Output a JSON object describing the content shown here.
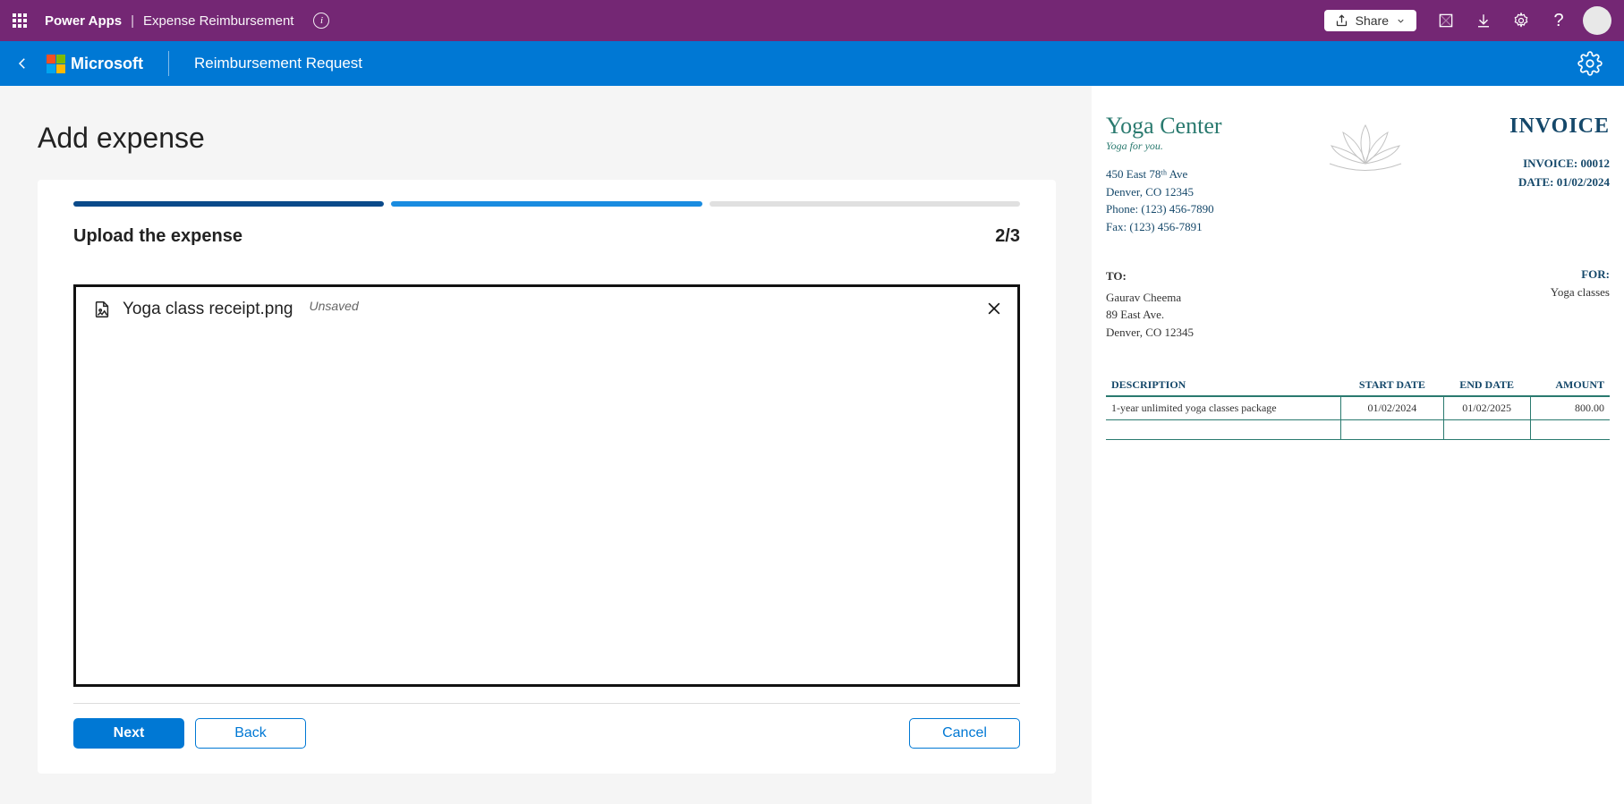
{
  "topbar": {
    "product": "Power Apps",
    "divider": "|",
    "app_name": "Expense Reimbursement",
    "share_label": "Share"
  },
  "appbar": {
    "brand": "Microsoft",
    "page": "Reimbursement Request"
  },
  "page": {
    "heading": "Add expense"
  },
  "wizard": {
    "step_title": "Upload the expense",
    "step_indicator": "2/3",
    "file": {
      "name": "Yoga class receipt.png",
      "status": "Unsaved"
    },
    "buttons": {
      "next": "Next",
      "back": "Back",
      "cancel": "Cancel"
    }
  },
  "invoice": {
    "brand": "Yoga Center",
    "tagline": "Yoga for you.",
    "title": "INVOICE",
    "address_line1": "450 East 78ᵗʰ Ave",
    "address_line2": "Denver, CO 12345",
    "phone": "Phone: (123) 456-7890",
    "fax": "Fax: (123) 456-7891",
    "meta_invoice_label": "INVOICE:",
    "meta_invoice_value": "00012",
    "meta_date_label": "DATE:",
    "meta_date_value": "01/02/2024",
    "to_label": "TO:",
    "to_name": "Gaurav Cheema",
    "to_addr1": "89 East Ave.",
    "to_addr2": "Denver, CO 12345",
    "for_label": "FOR:",
    "for_value": "Yoga classes",
    "col_desc": "DESCRIPTION",
    "col_start": "START DATE",
    "col_end": "END DATE",
    "col_amount": "AMOUNT",
    "row_desc": "1-year unlimited yoga classes package",
    "row_start": "01/02/2024",
    "row_end": "01/02/2025",
    "row_amount": "800.00"
  }
}
